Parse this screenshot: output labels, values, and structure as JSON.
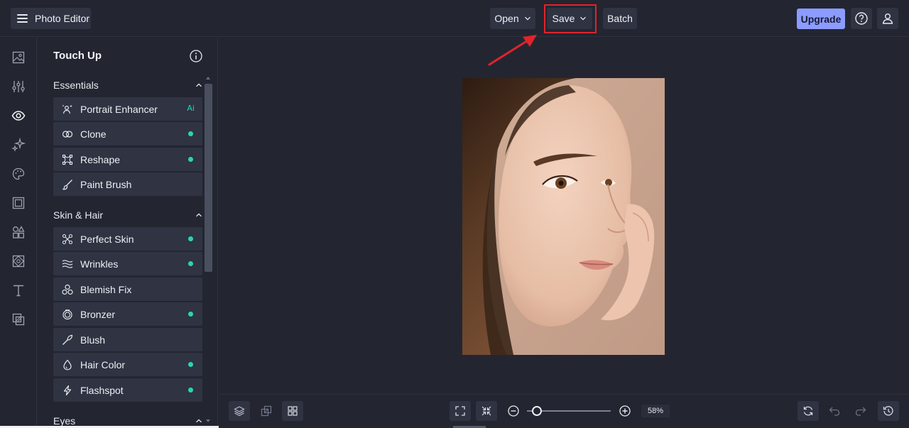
{
  "topbar": {
    "brand_label": "Photo Editor",
    "open_label": "Open",
    "save_label": "Save",
    "batch_label": "Batch",
    "upgrade_label": "Upgrade"
  },
  "rail": {
    "icons": [
      "image-icon",
      "adjustments-icon",
      "eye-icon",
      "sparkle-effects-icon",
      "palette-icon",
      "frame-icon",
      "elements-icon",
      "texture-icon",
      "text-icon",
      "overlay-icon"
    ]
  },
  "panel": {
    "title": "Touch Up",
    "sections": [
      {
        "label": "Essentials",
        "tools": [
          {
            "label": "Portrait Enhancer",
            "badge": "Ai"
          },
          {
            "label": "Clone",
            "badge": "dot"
          },
          {
            "label": "Reshape",
            "badge": "dot"
          },
          {
            "label": "Paint Brush",
            "badge": ""
          }
        ]
      },
      {
        "label": "Skin & Hair",
        "tools": [
          {
            "label": "Perfect Skin",
            "badge": "dot"
          },
          {
            "label": "Wrinkles",
            "badge": "dot"
          },
          {
            "label": "Blemish Fix",
            "badge": ""
          },
          {
            "label": "Bronzer",
            "badge": "dot"
          },
          {
            "label": "Blush",
            "badge": ""
          },
          {
            "label": "Hair Color",
            "badge": "dot"
          },
          {
            "label": "Flashspot",
            "badge": "dot"
          }
        ]
      },
      {
        "label": "Eyes",
        "tools": []
      }
    ]
  },
  "zoom": {
    "value_label": "58%",
    "level": 0.12
  },
  "colors": {
    "background": "#232631",
    "button": "#2f3342",
    "accent_dot": "#2ad4b4",
    "upgrade": "#8c9bff",
    "highlight": "#e0242b"
  }
}
